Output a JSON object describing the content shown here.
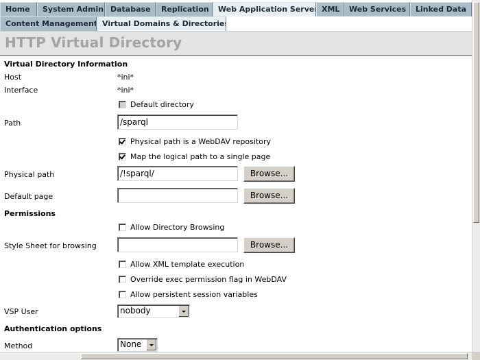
{
  "nav": {
    "row1": [
      "Home",
      "System Admin",
      "Database",
      "Replication",
      "Web Application Server",
      "XML",
      "Web Services",
      "Linked Data"
    ],
    "row2": [
      "Content Management",
      "Virtual Domains & Directories"
    ]
  },
  "page": {
    "title": "HTTP Virtual Directory"
  },
  "form": {
    "section_info": "Virtual Directory Information",
    "host_label": "Host",
    "host_value": "*ini*",
    "interface_label": "Interface",
    "interface_value": "*ini*",
    "default_dir_label": "Default directory",
    "path_label": "Path",
    "path_value": "/sparql",
    "webdav_label": "Physical path is a WebDAV repository",
    "map_single_label": "Map the logical path to a single page",
    "physical_path_label": "Physical path",
    "physical_path_value": "/!sparql/",
    "browse_label": "Browse...",
    "default_page_label": "Default page",
    "default_page_value": "",
    "section_permissions": "Permissions",
    "allow_dir_browsing_label": "Allow Directory Browsing",
    "stylesheet_label": "Style Sheet for browsing",
    "stylesheet_value": "",
    "allow_xml_label": "Allow XML template execution",
    "override_exec_label": "Override exec permission flag in WebDAV",
    "allow_session_label": "Allow persistent session variables",
    "vsp_user_label": "VSP User",
    "vsp_user_value": "nobody",
    "section_auth": "Authentication options",
    "method_label": "Method",
    "method_value": "None"
  },
  "state": {
    "default_dir_checked": false,
    "webdav_checked": true,
    "map_single_checked": true,
    "allow_dir_browsing_checked": false,
    "allow_xml_checked": false,
    "override_exec_checked": false,
    "allow_session_checked": false
  },
  "colors": {
    "tab": "#a9bcc8",
    "tab_active": "#e9eef2",
    "title_text": "#a3a3a3",
    "title_bg": "#e4e4e4"
  }
}
